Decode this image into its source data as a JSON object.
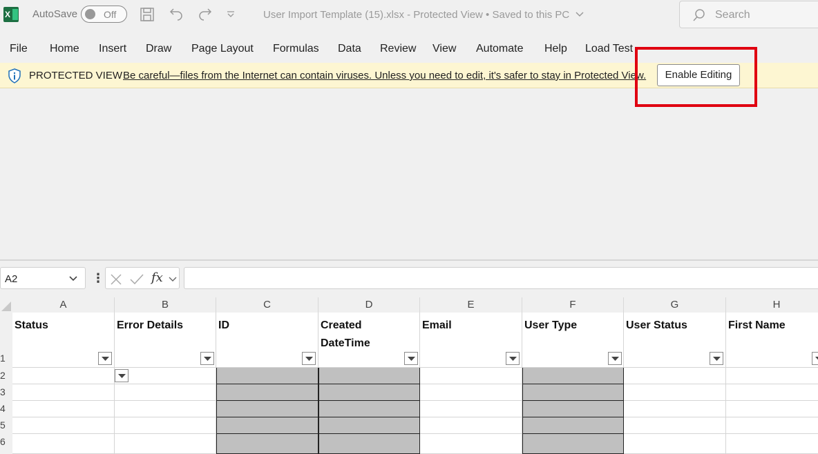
{
  "titlebar": {
    "autosave_label": "AutoSave",
    "autosave_state": "Off",
    "doc_title": "User Import Template (15).xlsx  -  Protected View • Saved to this PC",
    "search_placeholder": "Search"
  },
  "ribbon": {
    "tabs": [
      "File",
      "Home",
      "Insert",
      "Draw",
      "Page Layout",
      "Formulas",
      "Data",
      "Review",
      "View",
      "Automate",
      "Help",
      "Load Test"
    ]
  },
  "protected_view": {
    "title": "PROTECTED VIEW",
    "message": "Be careful—files from the Internet can contain viruses. Unless you need to edit, it's safer to stay in Protected View.",
    "button_label": "Enable Editing"
  },
  "formula_bar": {
    "name_box": "A2",
    "fx_label": "fx",
    "formula": ""
  },
  "sheet": {
    "columns": [
      "A",
      "B",
      "C",
      "D",
      "E",
      "F",
      "G",
      "H"
    ],
    "rows": [
      "1",
      "2",
      "3",
      "4",
      "5",
      "6"
    ],
    "headers": [
      "Status",
      "Error Details",
      "ID",
      "Created DateTime",
      "Email",
      "User Type",
      "User Status",
      "First Name"
    ]
  }
}
